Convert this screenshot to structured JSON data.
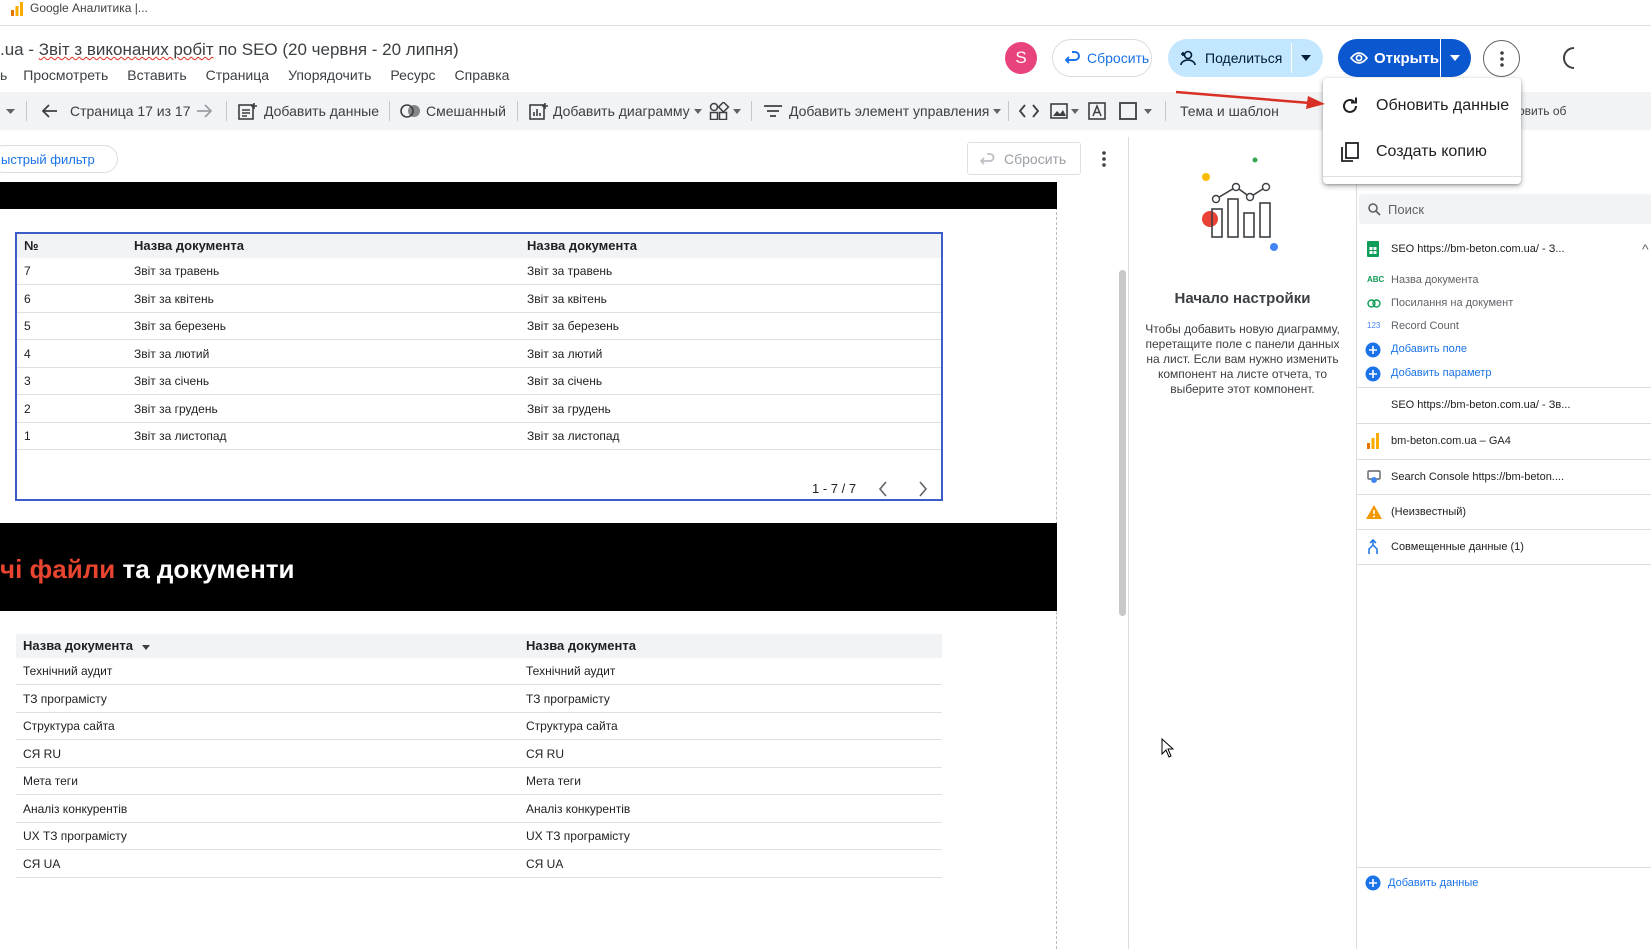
{
  "browser": {
    "tab_title": "Google Аналитика |..."
  },
  "header": {
    "title_prefix": ".ua - ",
    "title_underlined": "Звіт з виконаних робіт",
    "title_suffix": " по SEO (20 червня - 20 липня)",
    "menu": [
      "Просмотреть",
      "Вставить",
      "Страница",
      "Упорядочить",
      "Ресурс",
      "Справка"
    ],
    "avatar_letter": "S",
    "reset_label": "Сбросить",
    "share_label": "Поделиться",
    "open_label": "Открыть"
  },
  "toolbar": {
    "page_indicator": "Страница 17 из 17",
    "add_data": "Добавить данные",
    "blend": "Смешанный",
    "add_chart": "Добавить диаграмму",
    "add_control": "Добавить элемент управления",
    "theme": "Тема и шаблон",
    "cut_text": "овить об"
  },
  "filter_bar": {
    "quick_filter": "ыстрый фильтр",
    "reset_label": "Сбросить"
  },
  "table1": {
    "headers": [
      "№",
      "Назва документа",
      "Назва документа"
    ],
    "rows": [
      [
        "7",
        "Звіт за травень",
        "Звіт за травень"
      ],
      [
        "6",
        "Звіт за квітень",
        "Звіт за квітень"
      ],
      [
        "5",
        "Звіт за березень",
        "Звіт за березень"
      ],
      [
        "4",
        "Звіт за лютий",
        "Звіт за лютий"
      ],
      [
        "3",
        "Звіт за січень",
        "Звіт за січень"
      ],
      [
        "2",
        "Звіт за грудень",
        "Звіт за грудень"
      ],
      [
        "1",
        "Звіт за листопад",
        "Звіт за листопад"
      ]
    ],
    "pagination": "1 - 7 / 7"
  },
  "banner": {
    "red_text": "чі файли",
    "white_text": " та документи"
  },
  "table2": {
    "headers": [
      "Назва документа",
      "Назва документа"
    ],
    "rows": [
      [
        "Технічний аудит",
        "Технічний аудит"
      ],
      [
        "ТЗ програмісту",
        "ТЗ програмісту"
      ],
      [
        "Структура сайта",
        "Структура сайта"
      ],
      [
        "СЯ RU",
        "СЯ RU"
      ],
      [
        "Мета теги",
        "Мета теги"
      ],
      [
        "Аналіз конкурентів",
        "Аналіз конкурентів"
      ],
      [
        "UX ТЗ програмісту",
        "UX ТЗ програмісту"
      ],
      [
        "СЯ UA",
        "СЯ UA"
      ]
    ]
  },
  "setup_panel": {
    "title": "Начало настройки",
    "description": "Чтобы добавить новую диаграмму, перетащите поле с панели данных на лист. Если вам нужно изменить компонент на листе отчета, то выберите этот компонент."
  },
  "data_panel": {
    "search_placeholder": "Поиск",
    "source1": "SEO https://bm-beton.com.ua/ - З...",
    "fields": [
      {
        "type": "ABC",
        "label": "Назва документа"
      },
      {
        "type": "link",
        "label": "Посилання на документ"
      },
      {
        "type": "123",
        "label": "Record Count"
      }
    ],
    "add_field": "Добавить поле",
    "add_param": "Добавить параметр",
    "sources": [
      "SEO https://bm-beton.com.ua/ - Зв...",
      "bm-beton.com.ua – GA4",
      "Search Console https://bm-beton....",
      "(Неизвестный)",
      "Совмещенные данные (1)"
    ],
    "add_data": "Добавить данные"
  },
  "dropdown": {
    "items": [
      "Обновить данные",
      "Создать копию"
    ]
  },
  "colors": {
    "accent_blue": "#0b57d0",
    "share_bg": "#c2e7ff",
    "avatar": "#e8437c",
    "banner_red": "#e8442f",
    "arrow_red": "#d93025"
  }
}
